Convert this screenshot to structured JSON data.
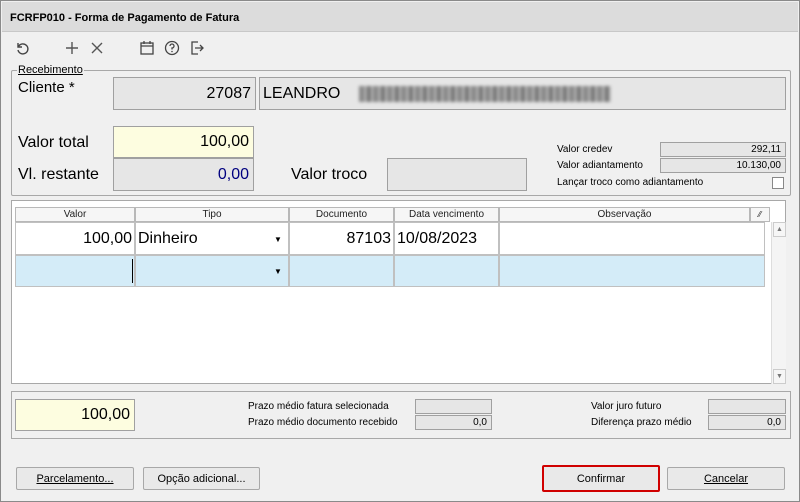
{
  "window": {
    "title": "FCRFP010 - Forma de Pagamento de Fatura"
  },
  "toolbar": {
    "icons": [
      "undo-icon",
      "plus-icon",
      "close-icon",
      "calendar-icon",
      "help-icon",
      "exit-icon"
    ]
  },
  "recebimento": {
    "group_label": "Recebimento",
    "cliente_label": "Cliente *",
    "cliente_code": "27087",
    "cliente_name": "LEANDRO"
  },
  "valores": {
    "valor_total_label": "Valor total",
    "valor_total": "100,00",
    "vl_restante_label": "Vl. restante",
    "vl_restante": "0,00",
    "valor_troco_label": "Valor troco",
    "valor_troco": "",
    "valor_credev_label": "Valor credev",
    "valor_credev": "292,11",
    "valor_adiantamento_label": "Valor adiantamento",
    "valor_adiantamento": "10.130,00",
    "lancar_troco_label": "Lançar troco como adiantamento"
  },
  "grid": {
    "headers": [
      "Valor",
      "Tipo",
      "Documento",
      "Data vencimento",
      "Observação"
    ],
    "rows": [
      {
        "valor": "100,00",
        "tipo": "Dinheiro",
        "documento": "87103",
        "data": "10/08/2023",
        "obs": ""
      },
      {
        "valor": "",
        "tipo": "",
        "documento": "",
        "data": "",
        "obs": ""
      }
    ]
  },
  "footer": {
    "total": "100,00",
    "prazo_fatura_label": "Prazo médio fatura selecionada",
    "prazo_fatura": "",
    "prazo_doc_label": "Prazo médio documento recebido",
    "prazo_doc": "0,0",
    "juro_label": "Valor juro futuro",
    "juro": "",
    "diferenca_label": "Diferença prazo médio",
    "diferenca": "0,0"
  },
  "buttons": {
    "parcelamento": "Parcelamento...",
    "opcao": "Opção adicional...",
    "confirmar": "Confirmar",
    "cancelar": "Cancelar"
  },
  "colors": {
    "highlight_row": "#d4ecf8",
    "confirm_border": "#d00000",
    "yellow_field": "#fdfde0",
    "blue_value": "#00007f"
  }
}
